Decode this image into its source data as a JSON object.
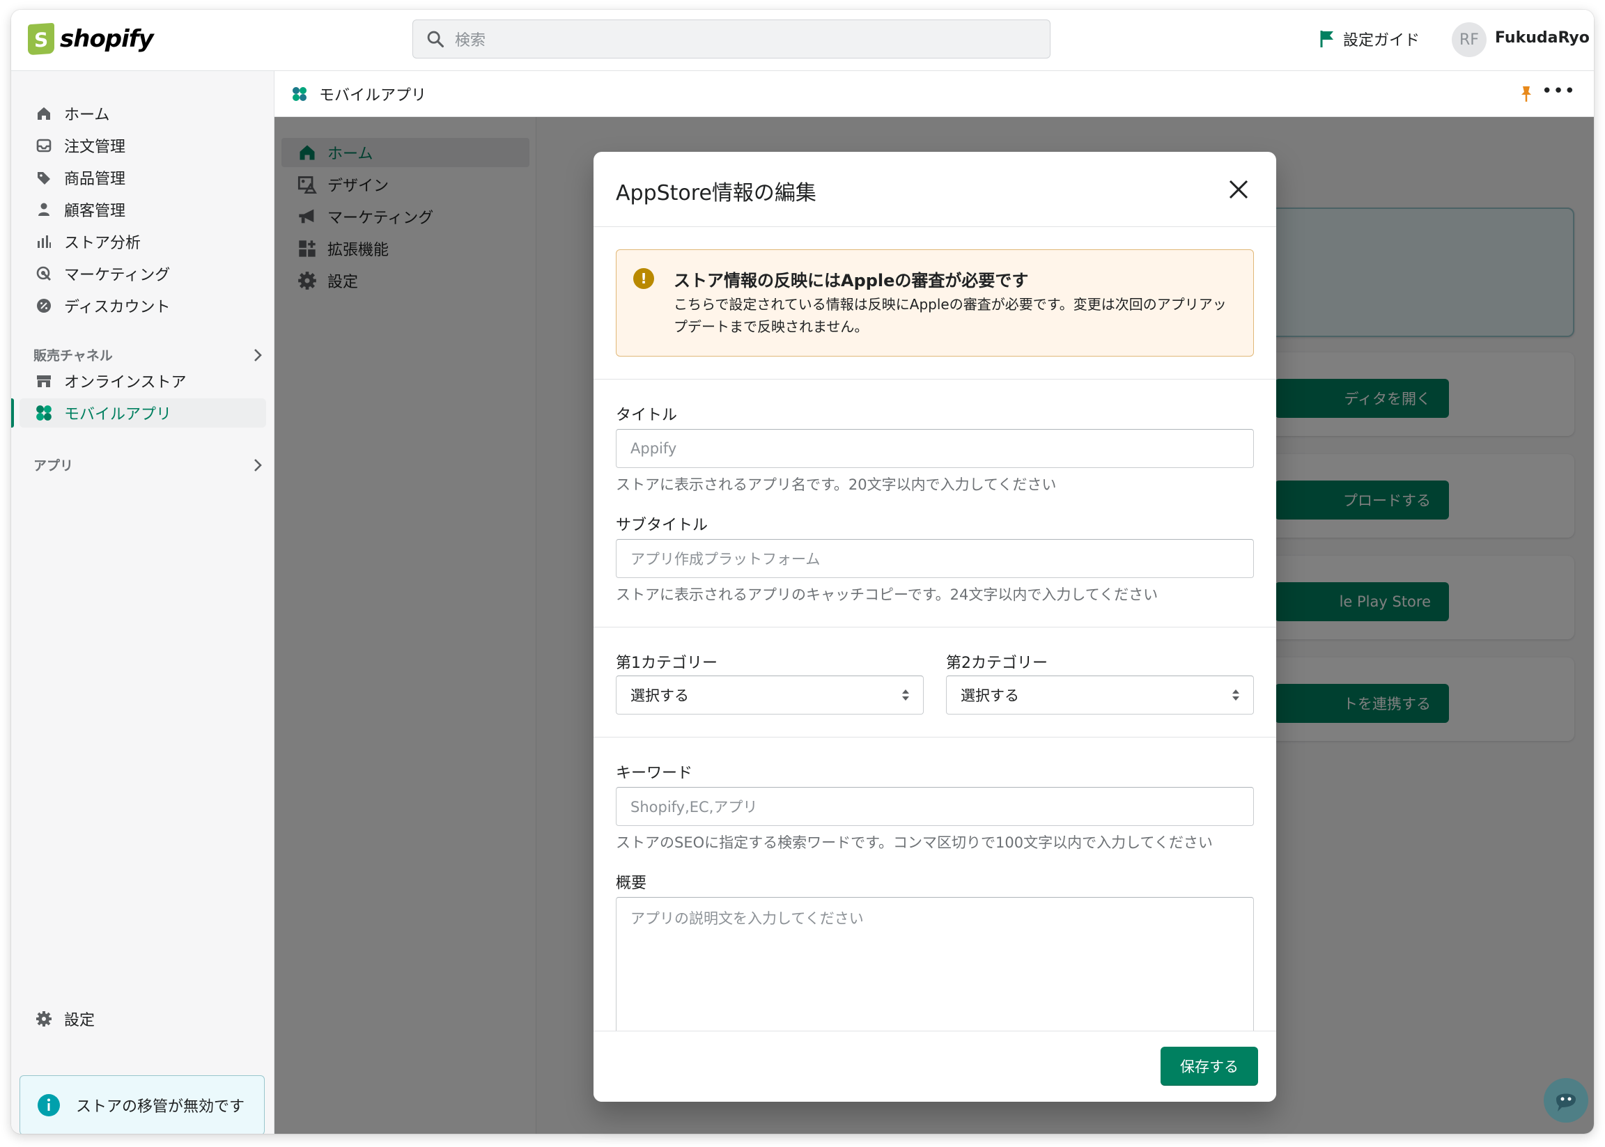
{
  "topbar": {
    "logo_text": "shopify",
    "search_placeholder": "検索",
    "guide_label": "設定ガイド",
    "avatar_initials": "RF",
    "user_name": "FukudaRyo"
  },
  "sidebar": {
    "items": [
      {
        "label": "ホーム",
        "icon": "home-icon"
      },
      {
        "label": "注文管理",
        "icon": "inbox-icon"
      },
      {
        "label": "商品管理",
        "icon": "tag-icon"
      },
      {
        "label": "顧客管理",
        "icon": "person-icon"
      },
      {
        "label": "ストア分析",
        "icon": "bar-chart-icon"
      },
      {
        "label": "マーケティング",
        "icon": "target-icon"
      },
      {
        "label": "ディスカウント",
        "icon": "discount-icon"
      }
    ],
    "sales_channels_header": "販売チャネル",
    "channels": [
      {
        "label": "オンラインストア",
        "icon": "store-icon"
      },
      {
        "label": "モバイルアプリ",
        "icon": "app-icon",
        "active": true
      }
    ],
    "apps_header": "アプリ",
    "settings_label": "設定",
    "banner_text": "ストアの移管が無効です"
  },
  "app_header": {
    "title": "モバイルアプリ"
  },
  "app_nav": [
    {
      "label": "ホーム",
      "icon": "home-icon",
      "active": true
    },
    {
      "label": "デザイン",
      "icon": "design-icon"
    },
    {
      "label": "マーケティング",
      "icon": "megaphone-icon"
    },
    {
      "label": "拡張機能",
      "icon": "apps-grid-icon"
    },
    {
      "label": "設定",
      "icon": "gear-icon"
    }
  ],
  "background_buttons": [
    "ディタを開く",
    "プロードする",
    "le Play Store",
    "トを連携する"
  ],
  "modal": {
    "title": "AppStore情報の編集",
    "warning": {
      "heading": "ストア情報の反映にはAppleの審査が必要です",
      "body": "こちらで設定されている情報は反映にAppleの審査が必要です。変更は次回のアプリアップデートまで反映されません。"
    },
    "title_field": {
      "label": "タイトル",
      "placeholder": "Appify",
      "help": "ストアに表示されるアプリ名です。20文字以内で入力してください"
    },
    "subtitle_field": {
      "label": "サブタイトル",
      "placeholder": "アプリ作成プラットフォーム",
      "help": "ストアに表示されるアプリのキャッチコピーです。24文字以内で入力してください"
    },
    "category1": {
      "label": "第1カテゴリー",
      "value": "選択する"
    },
    "category2": {
      "label": "第2カテゴリー",
      "value": "選択する"
    },
    "keyword_field": {
      "label": "キーワード",
      "placeholder": "Shopify,EC,アプリ",
      "help": "ストアのSEOに指定する検索ワードです。コンマ区切りで100文字以内で入力してください"
    },
    "description_field": {
      "label": "概要",
      "placeholder": "アプリの説明文を入力してください"
    },
    "save_label": "保存する"
  },
  "colors": {
    "primary": "#008060",
    "warning_bg": "#fff5ea",
    "info_bg": "#ebf9fc"
  }
}
